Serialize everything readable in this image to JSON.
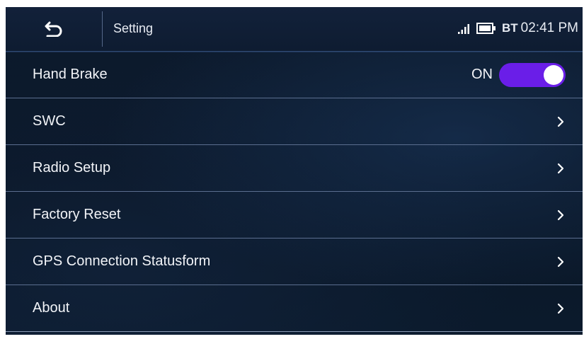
{
  "header": {
    "title": "Setting",
    "bt_label": "BT",
    "time": "02:41 PM"
  },
  "icons": {
    "back": "back-arrow-icon",
    "signal": "signal-strength-icon",
    "battery": "battery-icon",
    "chevron": "chevron-right-icon"
  },
  "menu": {
    "items": [
      {
        "label": "Hand Brake",
        "toggle_state": "ON",
        "toggle_on": true
      },
      {
        "label": "SWC"
      },
      {
        "label": "Radio Setup"
      },
      {
        "label": "Factory Reset"
      },
      {
        "label": "GPS Connection Statusform"
      },
      {
        "label": "About"
      }
    ]
  },
  "colors": {
    "toggle_on": "#6a1ee8",
    "background": "#0d1b2e",
    "text": "#f2f4f8"
  }
}
